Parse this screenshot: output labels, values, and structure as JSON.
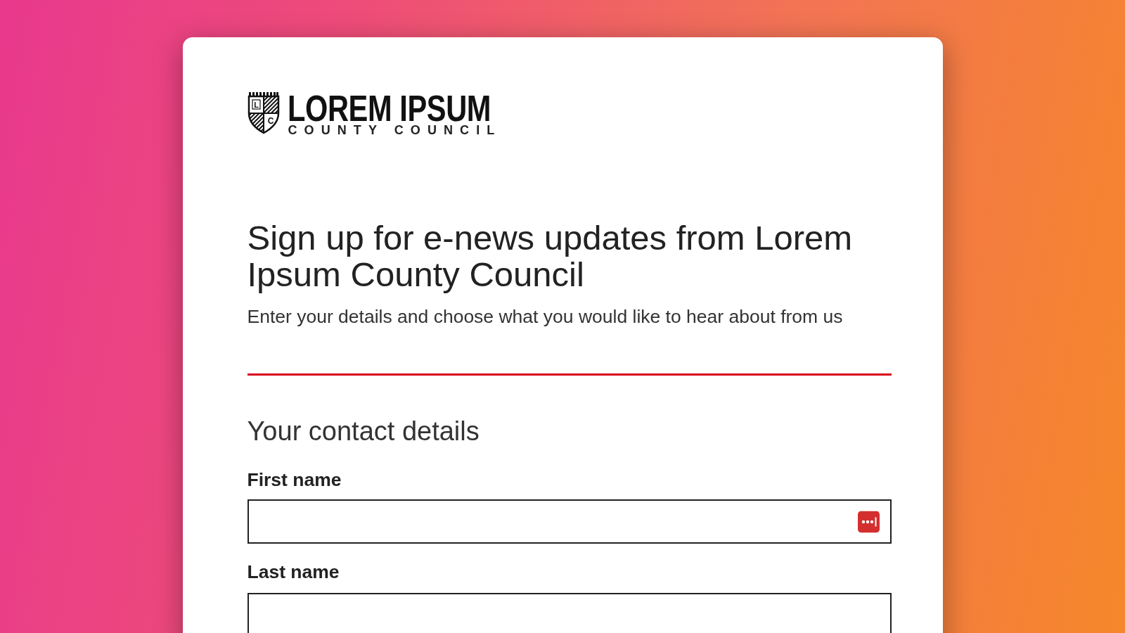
{
  "logo": {
    "shield_letters": [
      "L",
      "C"
    ],
    "name": "LOREM IPSUM",
    "subtitle": "COUNTY COUNCIL"
  },
  "heading": "Sign up for e-news updates from Lorem Ipsum County Council",
  "intro": "Enter your details and choose what you would like to hear about from us",
  "section": {
    "title": "Your contact details",
    "fields": [
      {
        "label": "First name",
        "autofill_button": true
      },
      {
        "label": "Last name",
        "autofill_button": false
      }
    ]
  }
}
